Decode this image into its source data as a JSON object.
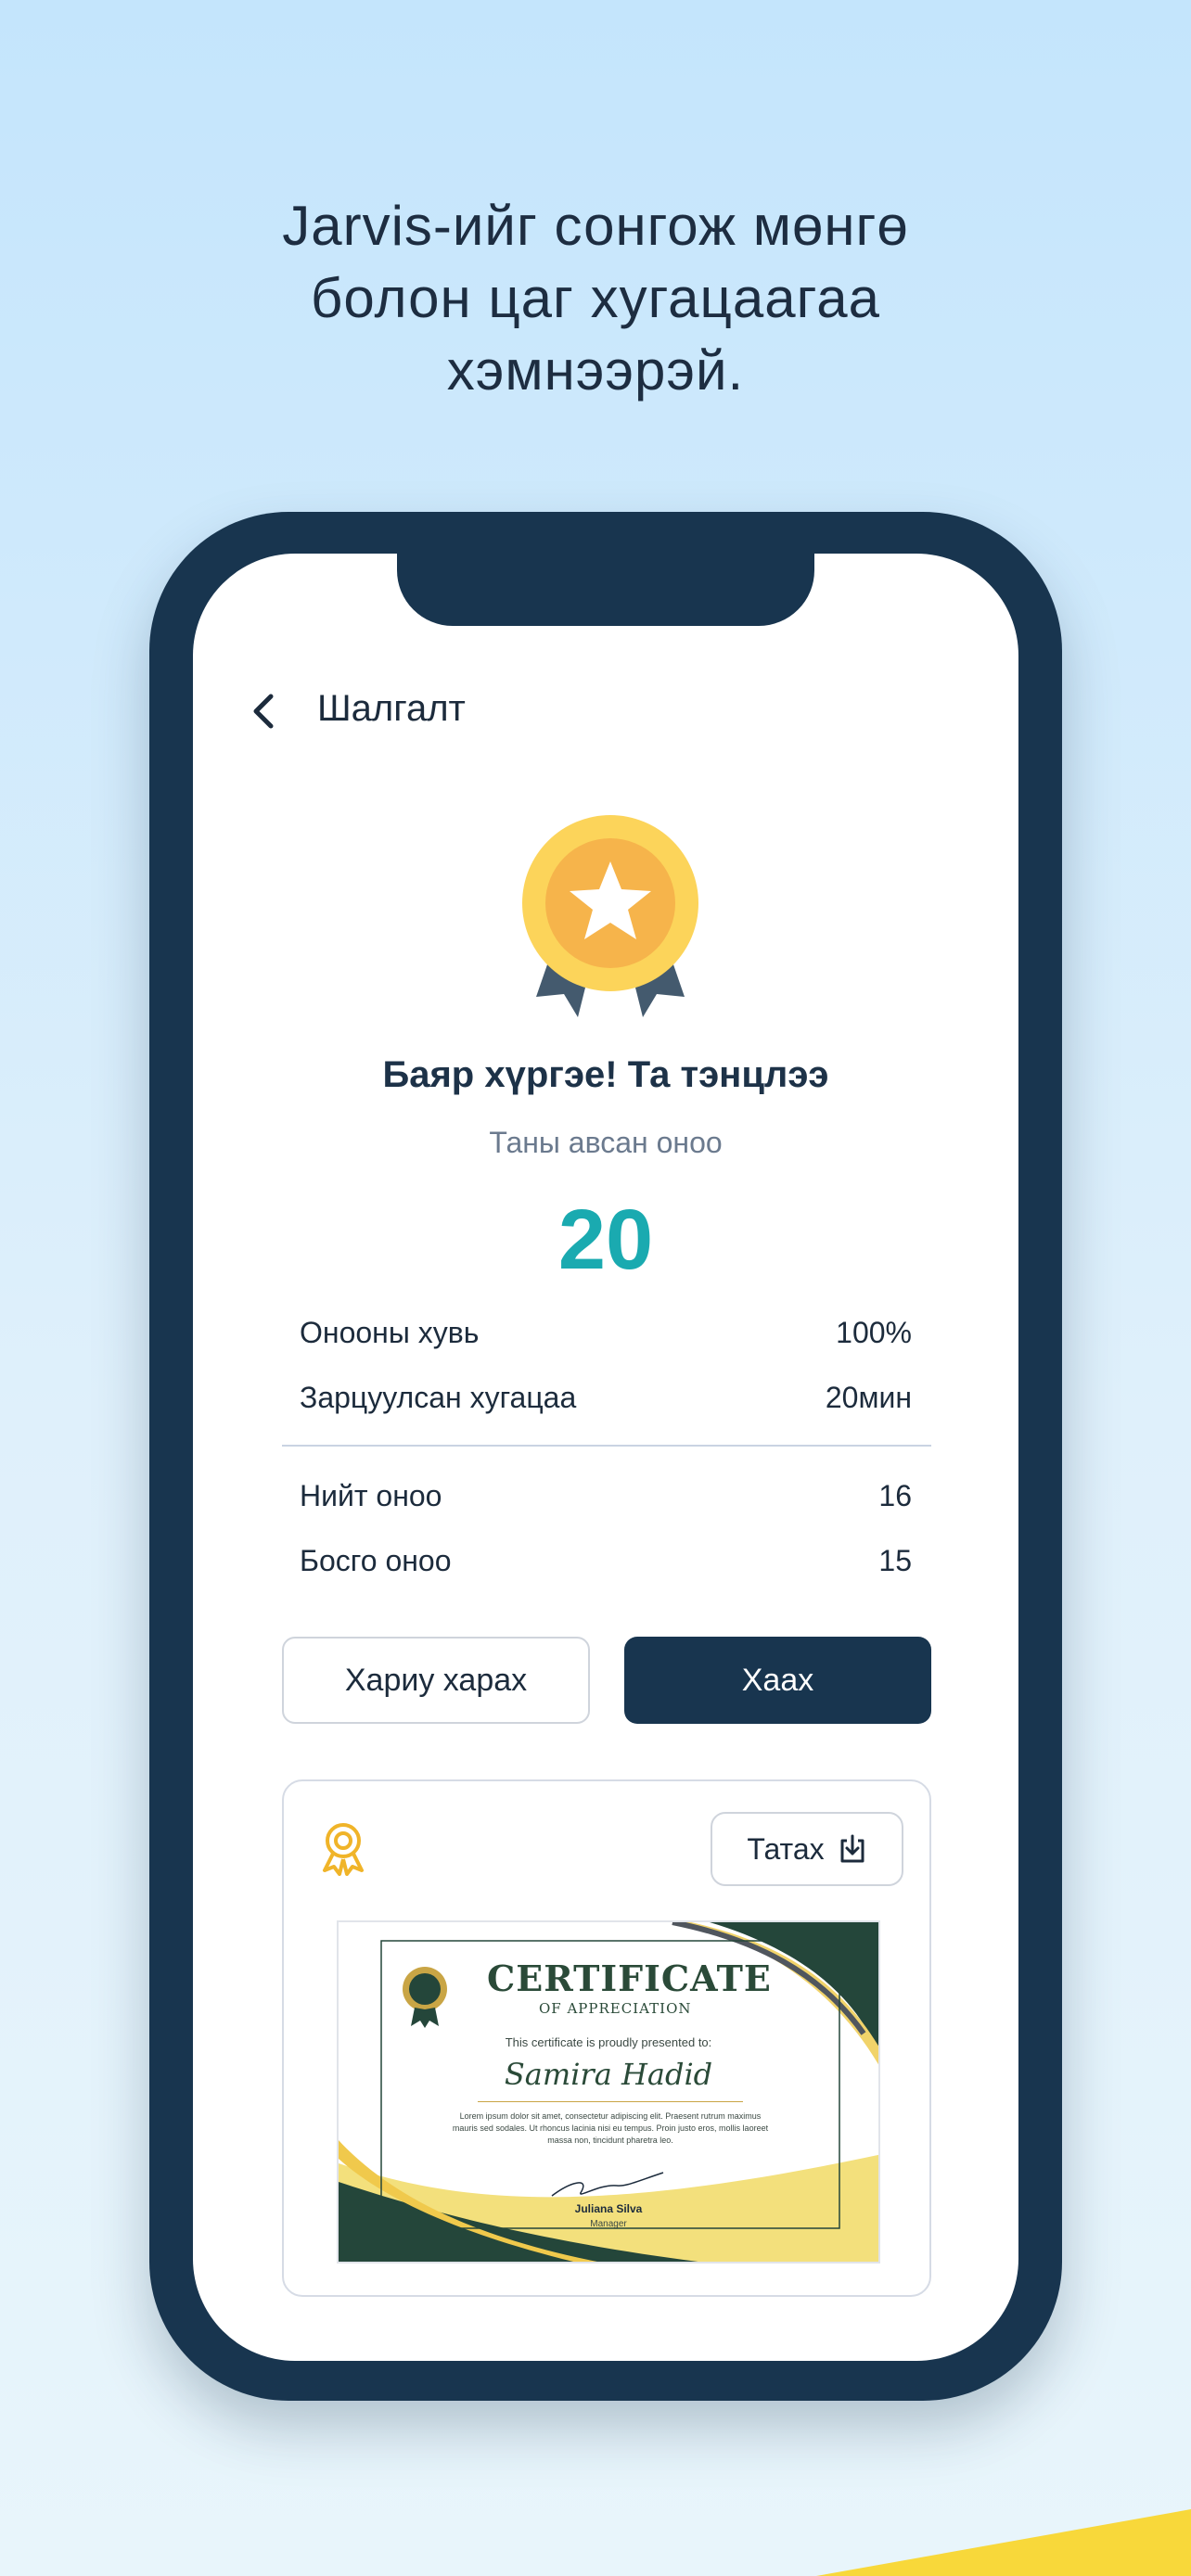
{
  "headline": {
    "line1": "Jarvis-ийг сонгож мөнгө",
    "line2": "болон цаг хугацаагаа",
    "line3": "хэмнээрэй."
  },
  "header": {
    "title": "Шалгалт"
  },
  "result": {
    "congrats": "Баяр хүргэе! Та тэнцлээ",
    "score_label": "Таны авсан оноо",
    "score": "20"
  },
  "stats": [
    {
      "label": "Онооны хувь",
      "value": "100%"
    },
    {
      "label": "Зарцуулсан хугацаа",
      "value": "20мин"
    },
    {
      "label": "Нийт оноо",
      "value": "16"
    },
    {
      "label": "Босго оноо",
      "value": "15"
    }
  ],
  "actions": {
    "review_label": "Хариу харах",
    "close_label": "Хаах"
  },
  "certificate_card": {
    "download_label": "Татах",
    "certificate": {
      "title": "CERTIFICATE",
      "subtitle": "OF APPRECIATION",
      "presented": "This certificate is proudly presented to:",
      "name": "Samira Hadid",
      "body": "Lorem ipsum dolor sit amet, consectetur adipiscing elit. Praesent rutrum maximus mauris sed sodales. Ut rhoncus lacinia nisi eu tempus. Proin justo eros, mollis laoreet massa non, tincidunt pharetra leo.",
      "signer": "Juliana Silva",
      "role": "Manager"
    }
  },
  "colors": {
    "primary_dark": "#18354f",
    "accent_teal": "#1aaab0",
    "medal_gold": "#fcd45a",
    "medal_inner": "#f6b44b"
  }
}
